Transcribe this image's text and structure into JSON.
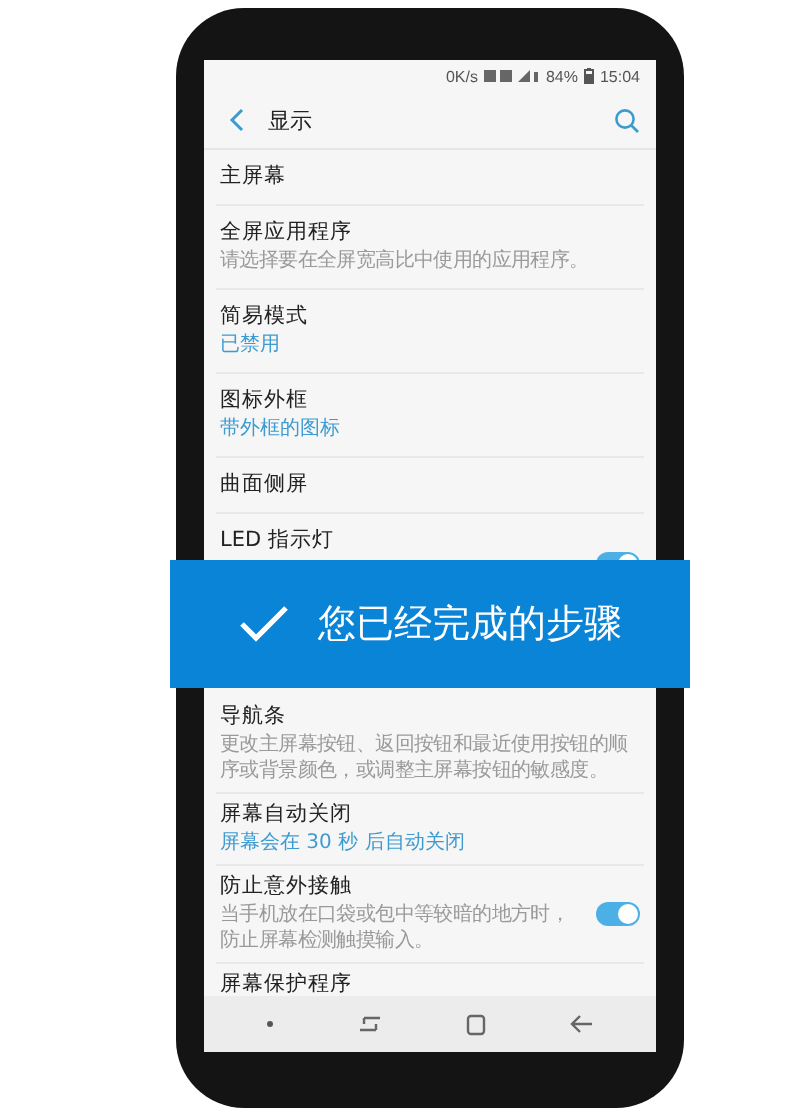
{
  "status_bar": {
    "speed": "0K/s",
    "battery": "84%",
    "time": "15:04"
  },
  "header": {
    "title": "显示"
  },
  "settings": [
    {
      "kind": "plain",
      "title": "主屏幕"
    },
    {
      "kind": "plain",
      "title": "全屏应用程序",
      "description": "请选择要在全屏宽高比中使用的应用程序。"
    },
    {
      "kind": "plain",
      "title": "简易模式",
      "summary": "已禁用"
    },
    {
      "kind": "plain",
      "title": "图标外框",
      "summary": "带外框的图标"
    },
    {
      "kind": "plain",
      "title": "曲面侧屏"
    },
    {
      "kind": "switch",
      "title": "LED 指示灯",
      "on": true
    },
    {
      "kind": "plain",
      "title": "导航条",
      "description": "更改主屏幕按钮、返回按钮和最近使用按钮的顺序或背景颜色，或调整主屏幕按钮的敏感度。"
    },
    {
      "kind": "plain",
      "title": "屏幕自动关闭",
      "summary": "屏幕会在 30 秒 后自动关闭"
    },
    {
      "kind": "switch",
      "title": "防止意外接触",
      "description": "当手机放在口袋或包中等较暗的地方时，防止屏幕检测触摸输入。",
      "on": true
    },
    {
      "kind": "plain",
      "title": "屏幕保护程序"
    }
  ],
  "banner": {
    "text": "您已经完成的步骤"
  }
}
